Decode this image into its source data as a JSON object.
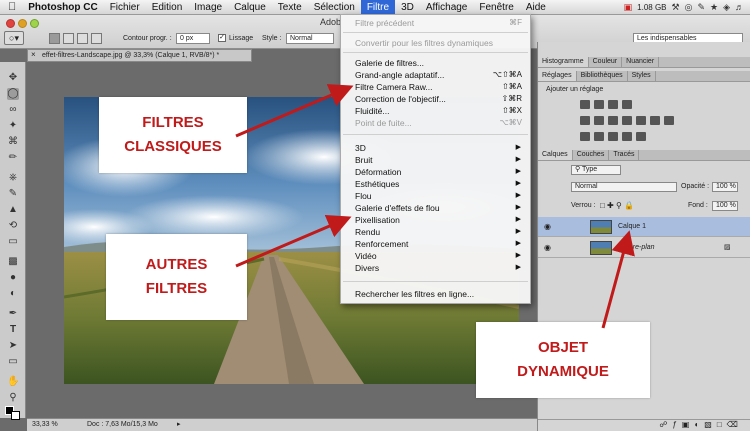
{
  "menubar": {
    "app_name": "Photoshop CC",
    "items": [
      "Fichier",
      "Edition",
      "Image",
      "Calque",
      "Texte",
      "Sélection",
      "Filtre",
      "3D",
      "Affichage",
      "Fenêtre",
      "Aide"
    ],
    "active": "Filtre",
    "memory": "1.08 GB"
  },
  "options": {
    "window_title": "Adob",
    "feather_label": "Contour progr. :",
    "feather_value": "0 px",
    "antialias_label": "Lissage",
    "style_label": "Style :",
    "style_value": "Normal",
    "workspace_value": "Les indispensables"
  },
  "document": {
    "tab_title": "effet-filtres-Landscape.jpg @ 33,3% (Calque 1, RVB/8*) *",
    "zoom": "33,33 %",
    "doc_info": "Doc : 7,63 Mo/15,3 Mo"
  },
  "filter_menu": {
    "items": [
      {
        "label": "Filtre précédent",
        "shortcut": "⌘F",
        "disabled": true
      },
      {
        "label": "Convertir pour les filtres dynamiques",
        "disabled": true
      },
      {
        "label": "Galerie de filtres..."
      },
      {
        "label": "Grand-angle adaptatif...",
        "shortcut": "⌥⇧⌘A"
      },
      {
        "label": "Filtre Camera Raw...",
        "shortcut": "⇧⌘A"
      },
      {
        "label": "Correction de l'objectif...",
        "shortcut": "⇧⌘R"
      },
      {
        "label": "Fluidité...",
        "shortcut": "⇧⌘X"
      },
      {
        "label": "Point de fuite...",
        "shortcut": "⌥⌘V",
        "disabled": true
      },
      {
        "label": "3D",
        "submenu": true
      },
      {
        "label": "Bruit",
        "submenu": true
      },
      {
        "label": "Déformation",
        "submenu": true
      },
      {
        "label": "Esthétiques",
        "submenu": true
      },
      {
        "label": "Flou",
        "submenu": true
      },
      {
        "label": "Galerie d'effets de flou",
        "submenu": true
      },
      {
        "label": "Pixellisation",
        "submenu": true
      },
      {
        "label": "Rendu",
        "submenu": true
      },
      {
        "label": "Renforcement",
        "submenu": true
      },
      {
        "label": "Vidéo",
        "submenu": true
      },
      {
        "label": "Divers",
        "submenu": true
      },
      {
        "label": "Rechercher les filtres en ligne..."
      }
    ]
  },
  "panels": {
    "top_tabs": [
      "Histogramme",
      "Couleur",
      "Nuancier"
    ],
    "adj_tabs": [
      "Réglages",
      "Bibliothèques",
      "Styles"
    ],
    "adj_title": "Ajouter un réglage",
    "layer_tabs": [
      "Calques",
      "Couches",
      "Tracés"
    ],
    "filter_type": "Type",
    "blend_mode": "Normal",
    "opacity_label": "Opacité :",
    "opacity_value": "100 %",
    "lock_label": "Verrou :",
    "fill_label": "Fond :",
    "fill_value": "100 %",
    "layers": [
      "Calque 1",
      "Arrière-plan"
    ]
  },
  "callouts": {
    "classic": "FILTRES\nCLASSIQUES",
    "other": "AUTRES\nFILTRES",
    "smart": "OBJET\nDYNAMIQUE"
  },
  "colors": {
    "accent": "#2f68d6",
    "callout_text": "#c11a1a",
    "arrow": "#c01a1a"
  }
}
